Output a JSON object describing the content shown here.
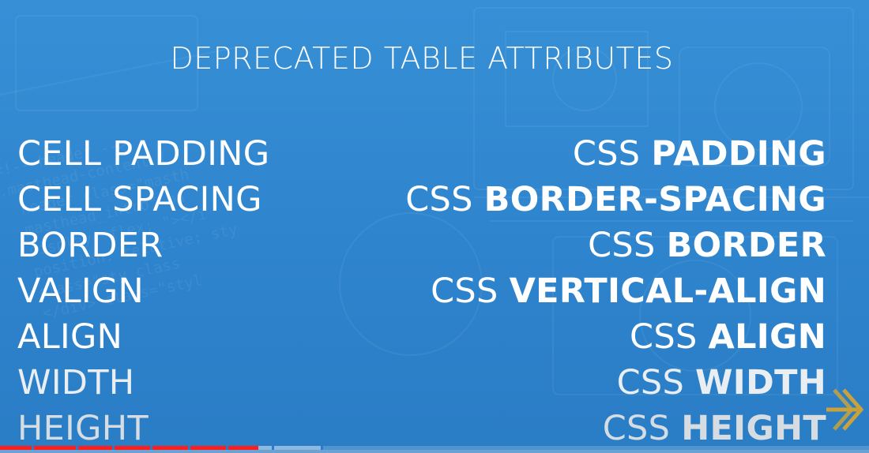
{
  "slide": {
    "title": "DEPRECATED TABLE ATTRIBUTES",
    "attributes": [
      {
        "deprecated": "CELL PADDING",
        "css_prefix": "CSS",
        "css_property": "PADDING"
      },
      {
        "deprecated": "CELL SPACING",
        "css_prefix": "CSS",
        "css_property": "BORDER-SPACING"
      },
      {
        "deprecated": "BORDER",
        "css_prefix": "CSS",
        "css_property": "BORDER"
      },
      {
        "deprecated": "VALIGN",
        "css_prefix": "CSS",
        "css_property": "VERTICAL-ALIGN"
      },
      {
        "deprecated": "ALIGN",
        "css_prefix": "CSS",
        "css_property": "ALIGN"
      },
      {
        "deprecated": "WIDTH",
        "css_prefix": "CSS",
        "css_property": "WIDTH"
      },
      {
        "deprecated": "HEIGHT",
        "css_prefix": "CSS",
        "css_property": "HEIGHT"
      }
    ],
    "colors": {
      "background": "#2f86cf",
      "text": "#ffffff",
      "arrow": "#c9a23a"
    }
  },
  "player": {
    "played_fraction": 0.297,
    "buffered_fraction": 0.37,
    "icons": [
      "forward-arrow-icon"
    ]
  }
}
